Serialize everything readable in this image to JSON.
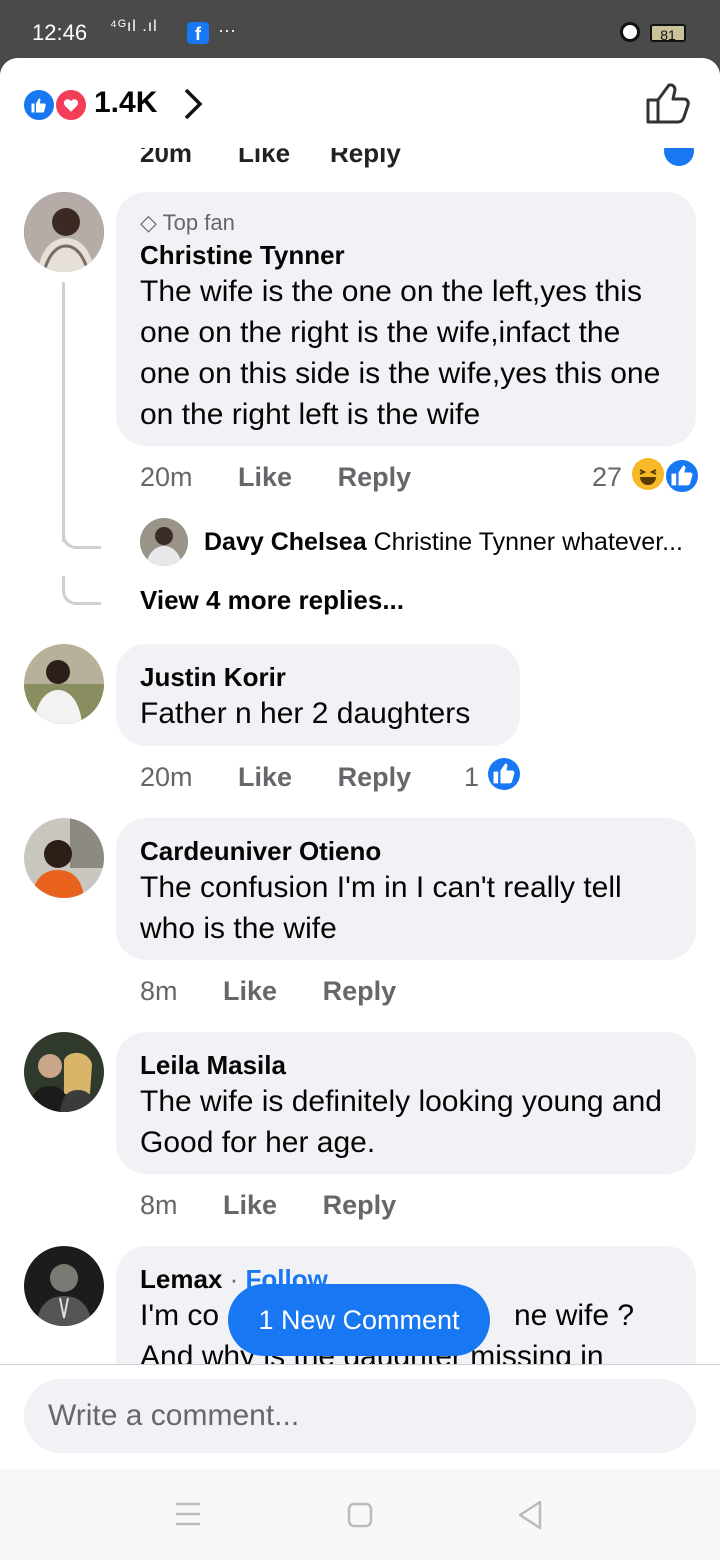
{
  "status": {
    "time": "12:46",
    "signal": "⁴ᴳıl .ıl",
    "battery": "81",
    "more": "···"
  },
  "header": {
    "reaction_count": "1.4K"
  },
  "ghost_row": {
    "time": "20m",
    "like": "Like",
    "reply": "Reply"
  },
  "comments": [
    {
      "badge": "Top fan",
      "name": "Christine Tynner",
      "text": "The wife is the one on the left,yes this one on the right is the wife,infact the one on this side is the wife,yes this one on the right left is the wife",
      "time": "20m",
      "like": "Like",
      "reply": "Reply",
      "reaction_count": "27",
      "reply_preview": {
        "name": "Davy Chelsea",
        "text": "Christine Tynner whatever..."
      },
      "view_more": "View 4 more replies..."
    },
    {
      "name": "Justin Korir",
      "text": "Father n her 2 daughters",
      "time": "20m",
      "like": "Like",
      "reply": "Reply",
      "reaction_count": "1"
    },
    {
      "name": "Cardeuniver Otieno",
      "text": "The confusion I'm in I can't really tell who is the wife",
      "time": "8m",
      "like": "Like",
      "reply": "Reply"
    },
    {
      "name": "Leila Masila",
      "text": "The wife is definitely looking young and Good for her age.",
      "time": "8m",
      "like": "Like",
      "reply": "Reply"
    },
    {
      "name": "Lemax",
      "follow": "Follow",
      "separator": "·",
      "text_line1_start": "I'm co",
      "text_line1_end": "ne wife ?",
      "text_line2": "And why is the daughter missing in"
    }
  ],
  "new_comment_pill": "1 New Comment",
  "composer": {
    "placeholder": "Write a comment..."
  },
  "colors": {
    "accent": "#1877f2",
    "bubble": "#f0f2f5",
    "muted": "#65676b",
    "love": "#f33e58"
  }
}
